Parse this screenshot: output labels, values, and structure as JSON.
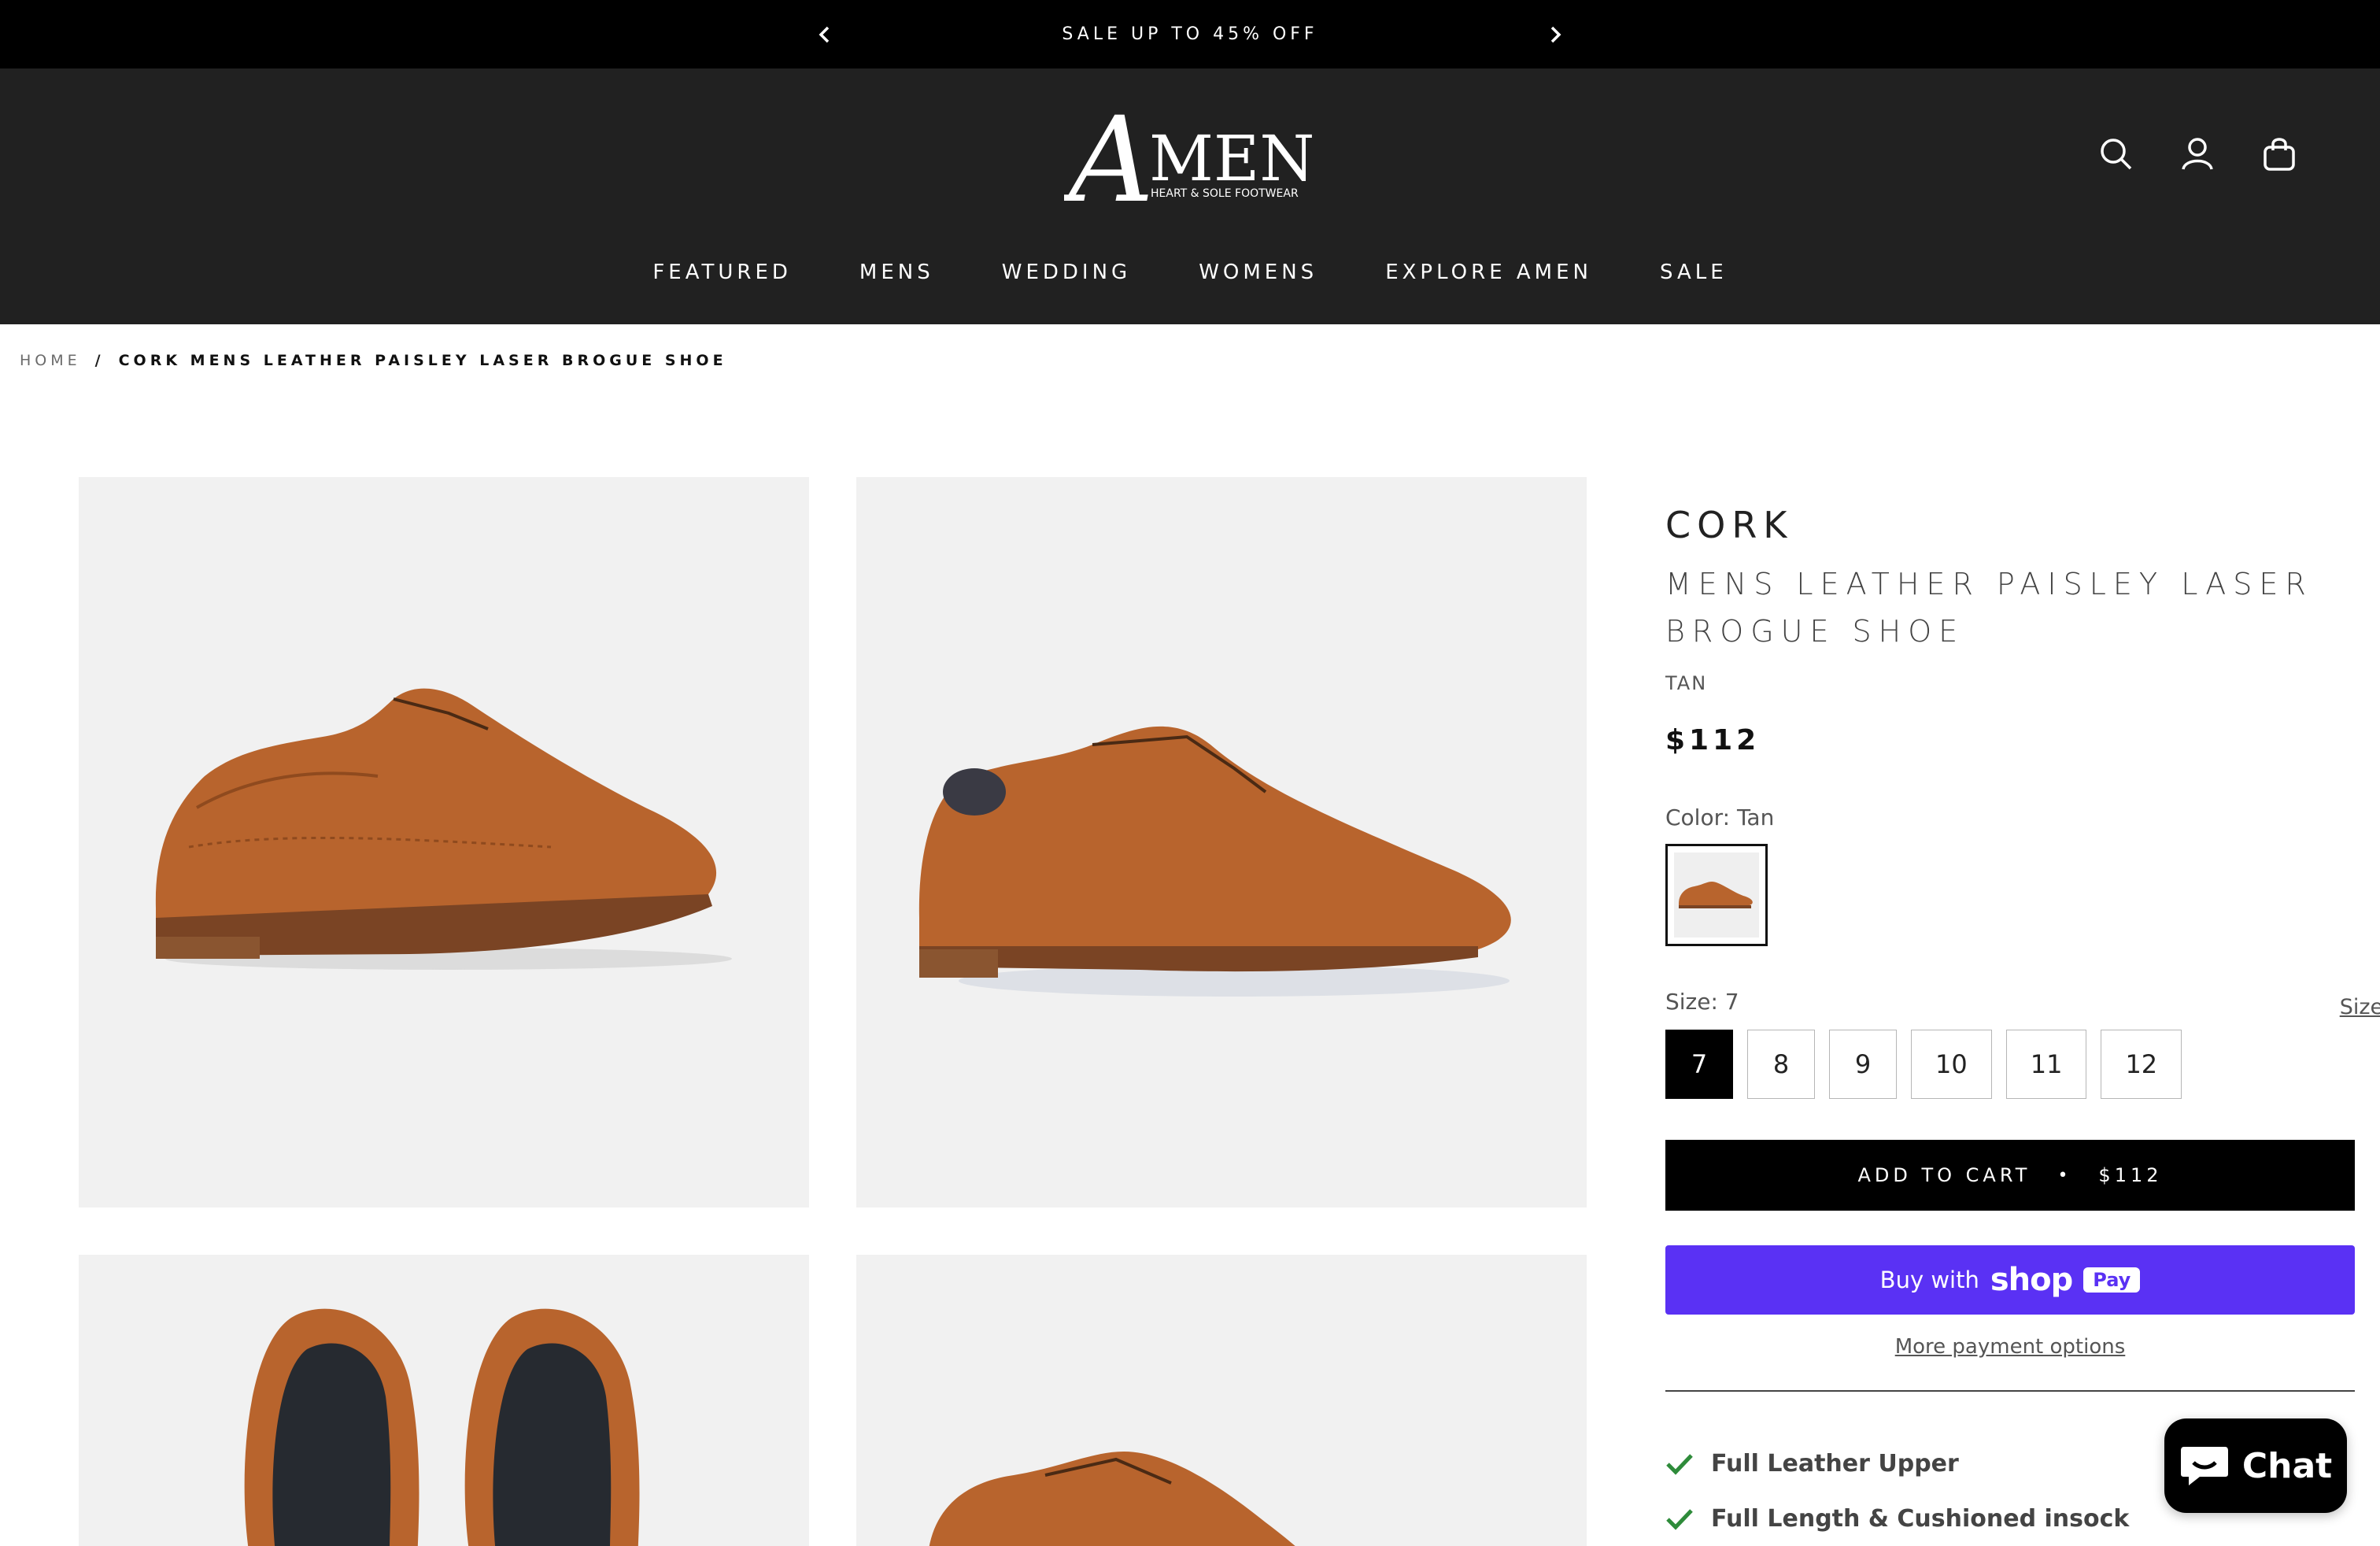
{
  "announcement": {
    "text": "SALE UP TO 45% OFF"
  },
  "header": {
    "logo_letter": "A",
    "logo_word": "MEN",
    "logo_tagline": "HEART & SOLE FOOTWEAR",
    "icons": [
      "search-icon",
      "account-icon",
      "cart-icon"
    ]
  },
  "nav": [
    "FEATURED",
    "MENS",
    "WEDDING",
    "WOMENS",
    "EXPLORE AMEN",
    "SALE"
  ],
  "breadcrumb": {
    "home": "HOME",
    "separator": "/",
    "current": "CORK MENS LEATHER PAISLEY LASER BROGUE SHOE"
  },
  "product": {
    "brand": "CORK",
    "name_line1": "MENS LEATHER PAISLEY LASER",
    "name_line2": "BROGUE SHOE",
    "color": "TAN",
    "price": "$112",
    "color_label": "Color: Tan",
    "size_label": "Size: 7",
    "size_guide": "Size Guide",
    "sizes": [
      "7",
      "8",
      "9",
      "10",
      "11",
      "12"
    ],
    "selected_size": "7",
    "add_to_cart": "ADD TO CART",
    "add_to_cart_dot": "•",
    "add_to_cart_price": "$112",
    "shoppay_buy": "Buy with",
    "shoppay_shop": "shop",
    "shoppay_pay": "Pay",
    "more_payment": "More payment options",
    "features": [
      "Full Leather Upper",
      "Full Length & Cushioned insock"
    ]
  },
  "chat": {
    "label": "Chat"
  },
  "colors": {
    "announce_bg": "#000000",
    "header_bg": "#212121",
    "shoppay": "#5a31f4",
    "check": "#2e8b3a",
    "leather": "#b8642d"
  }
}
